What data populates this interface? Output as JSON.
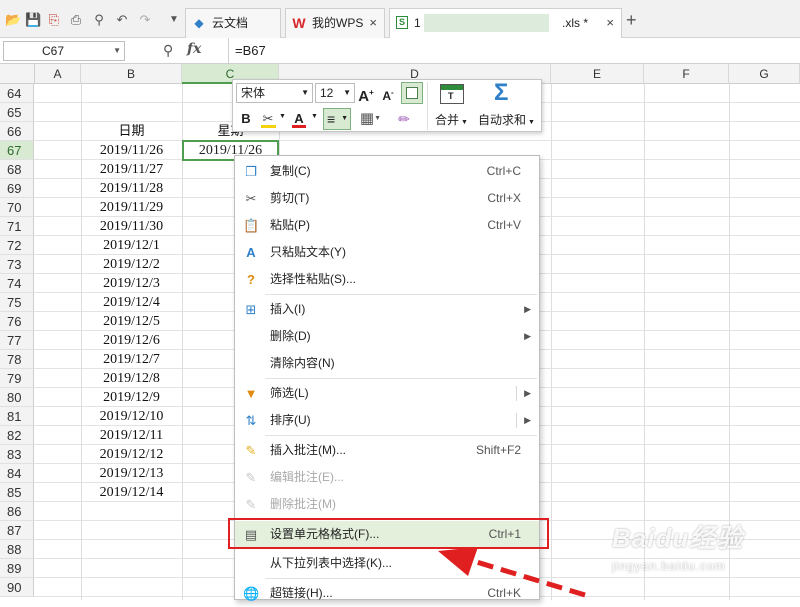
{
  "titlebar": {
    "tabs": [
      {
        "label": "云文档",
        "icon": "cloud-doc-icon"
      },
      {
        "label": "我的WPS",
        "icon": "wps-logo-icon"
      },
      {
        "label": "1",
        "icon": "spreadsheet-icon"
      },
      {
        "label": ".xls *",
        "icon": ""
      }
    ],
    "new_tab_label": "+",
    "close_label": "×"
  },
  "formula_bar": {
    "cell_ref": "C67",
    "fx_label": "fx",
    "formula": "=B67"
  },
  "grid": {
    "columns": [
      "A",
      "B",
      "C",
      "D",
      "E",
      "F",
      "G"
    ],
    "selected_column": "C",
    "rows": [
      "64",
      "65",
      "66",
      "67",
      "68",
      "69",
      "70",
      "71",
      "72",
      "73",
      "74",
      "75",
      "76",
      "77",
      "78",
      "79",
      "80",
      "81",
      "82",
      "83",
      "84",
      "85",
      "86",
      "87",
      "88",
      "89",
      "90"
    ],
    "selected_row": "67",
    "header_date": "日期",
    "header_weekday": "星期",
    "active_cell_value": "2019/11/26",
    "dates": [
      "2019/11/26",
      "2019/11/27",
      "2019/11/28",
      "2019/11/29",
      "2019/11/30",
      "2019/12/1",
      "2019/12/2",
      "2019/12/3",
      "2019/12/4",
      "2019/12/5",
      "2019/12/6",
      "2019/12/7",
      "2019/12/8",
      "2019/12/9",
      "2019/12/10",
      "2019/12/11",
      "2019/12/12",
      "2019/12/13",
      "2019/12/14"
    ]
  },
  "mini_toolbar": {
    "font_name": "宋体",
    "font_size": "12",
    "grow_font": "A",
    "shrink_font": "A",
    "bold": "B",
    "font_color": "A",
    "merge_label": "合并",
    "autosum_label": "自动求和"
  },
  "context_menu": {
    "items": [
      {
        "label": "复制(C)",
        "shortcut": "Ctrl+C",
        "icon": "copy-icon"
      },
      {
        "label": "剪切(T)",
        "shortcut": "Ctrl+X",
        "icon": "scissors-icon"
      },
      {
        "label": "粘贴(P)",
        "shortcut": "Ctrl+V",
        "icon": "paste-icon"
      },
      {
        "label": "只粘贴文本(Y)",
        "shortcut": "",
        "icon": "paste-text-icon"
      },
      {
        "label": "选择性粘贴(S)...",
        "shortcut": "",
        "icon": "paste-special-icon"
      },
      {
        "label": "插入(I)",
        "shortcut": "",
        "icon": "insert-icon"
      },
      {
        "label": "删除(D)",
        "shortcut": "",
        "icon": ""
      },
      {
        "label": "清除内容(N)",
        "shortcut": "",
        "icon": ""
      },
      {
        "label": "筛选(L)",
        "shortcut": "",
        "icon": "filter-icon"
      },
      {
        "label": "排序(U)",
        "shortcut": "",
        "icon": "sort-icon"
      },
      {
        "label": "插入批注(M)...",
        "shortcut": "Shift+F2",
        "icon": "insert-comment-icon"
      },
      {
        "label": "编辑批注(E)...",
        "shortcut": "",
        "icon": "edit-comment-icon"
      },
      {
        "label": "删除批注(M)",
        "shortcut": "",
        "icon": "delete-comment-icon"
      },
      {
        "label": "设置单元格格式(F)...",
        "shortcut": "Ctrl+1",
        "icon": "format-cells-icon"
      },
      {
        "label": "从下拉列表中选择(K)...",
        "shortcut": "",
        "icon": ""
      },
      {
        "label": "超链接(H)...",
        "shortcut": "Ctrl+K",
        "icon": "hyperlink-icon"
      }
    ]
  },
  "watermark": {
    "line1": "Baidu经验",
    "line2": "jingyan.baidu.com"
  },
  "colors": {
    "accent_green": "#4f9d4f",
    "highlight": "#e02020",
    "arrow_red": "#e02020"
  }
}
